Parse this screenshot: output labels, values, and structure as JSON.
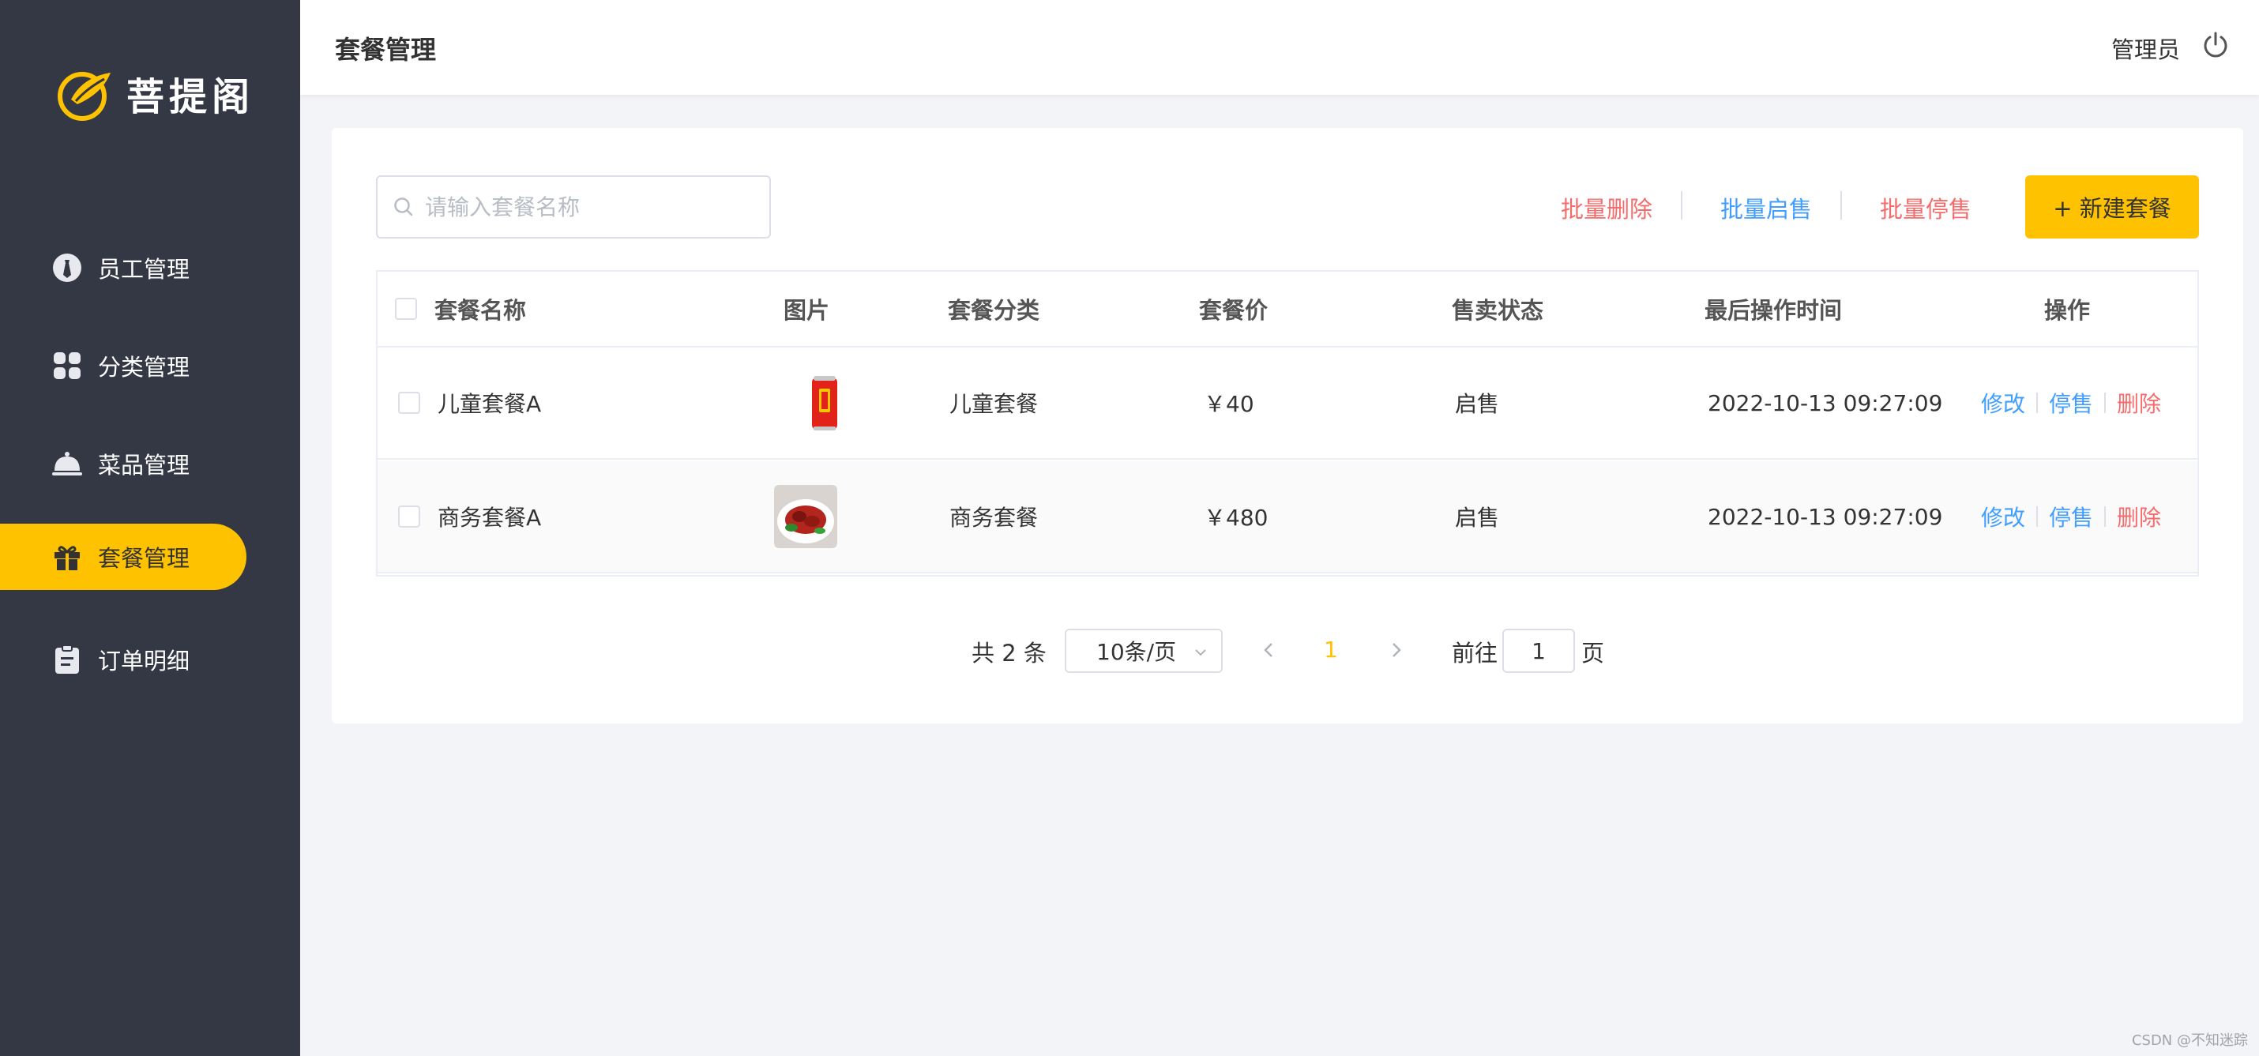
{
  "brand": {
    "name": "菩提阁"
  },
  "sidebar": {
    "items": [
      {
        "label": "员工管理",
        "icon": "employee-icon"
      },
      {
        "label": "分类管理",
        "icon": "grid-icon"
      },
      {
        "label": "菜品管理",
        "icon": "dish-cloche-icon"
      },
      {
        "label": "套餐管理",
        "icon": "gift-icon",
        "active": true
      },
      {
        "label": "订单明细",
        "icon": "clipboard-icon"
      }
    ]
  },
  "header": {
    "title": "套餐管理",
    "user": "管理员"
  },
  "toolbar": {
    "search_placeholder": "请输入套餐名称",
    "batch_delete": "批量删除",
    "batch_enable": "批量启售",
    "batch_disable": "批量停售",
    "new_button": "+ 新建套餐"
  },
  "table": {
    "columns": [
      "套餐名称",
      "图片",
      "套餐分类",
      "套餐价",
      "售卖状态",
      "最后操作时间",
      "操作"
    ],
    "rows": [
      {
        "name": "儿童套餐A",
        "image": "drink-can",
        "category": "儿童套餐",
        "price": "￥40",
        "status": "启售",
        "updated": "2022-10-13 09:27:09"
      },
      {
        "name": "商务套餐A",
        "image": "meat-dish",
        "category": "商务套餐",
        "price": "￥480",
        "status": "启售",
        "updated": "2022-10-13 09:27:09"
      }
    ],
    "actions": {
      "edit": "修改",
      "disable": "停售",
      "delete": "删除"
    }
  },
  "pagination": {
    "total": "共 2 条",
    "page_size": "10条/页",
    "current_page": "1",
    "goto_label": "前往",
    "goto_value": "1",
    "goto_unit": "页"
  },
  "watermark": "CSDN @不知迷踪",
  "colors": {
    "accent": "#ffc200",
    "sidebar": "#343744",
    "link_blue": "#419eff",
    "link_red": "#f56c6c"
  }
}
